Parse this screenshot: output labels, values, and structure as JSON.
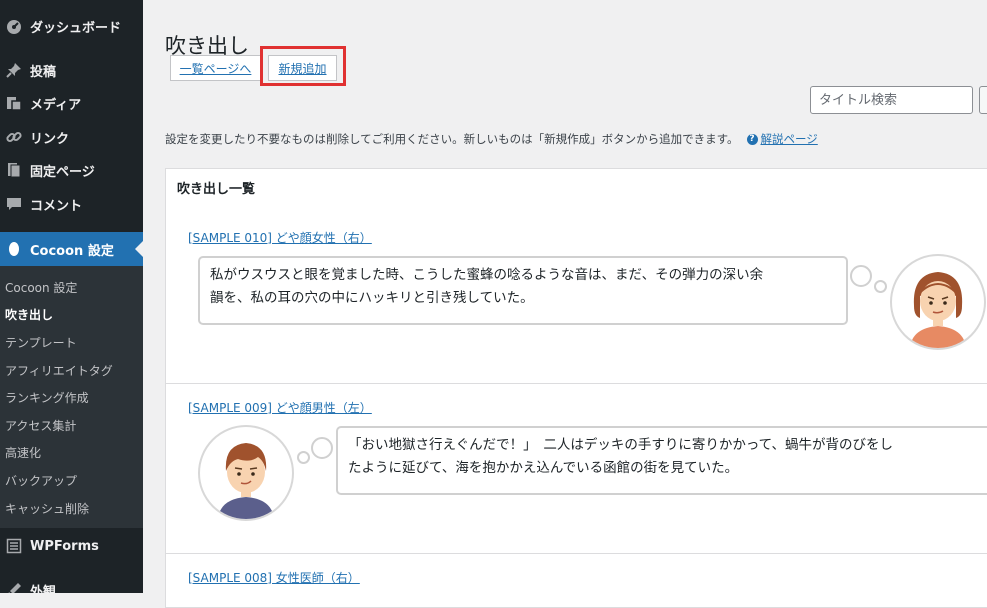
{
  "sidebar": {
    "menu": [
      {
        "label": "ダッシュボード",
        "icon": "dashboard-icon"
      },
      {
        "label": "投稿",
        "icon": "pin-icon"
      },
      {
        "label": "メディア",
        "icon": "media-icon"
      },
      {
        "label": "リンク",
        "icon": "link-icon"
      },
      {
        "label": "固定ページ",
        "icon": "page-icon"
      },
      {
        "label": "コメント",
        "icon": "comment-icon"
      },
      {
        "label": "Cocoon 設定",
        "icon": "cocoon-icon",
        "active": true
      },
      {
        "label": "WPForms",
        "icon": "forms-icon"
      },
      {
        "label": "外観",
        "icon": "appearance-icon"
      }
    ],
    "submenu": [
      "Cocoon 設定",
      "吹き出し",
      "テンプレート",
      "アフィリエイトタグ",
      "ランキング作成",
      "アクセス集計",
      "高速化",
      "バックアップ",
      "キャッシュ削除"
    ],
    "submenu_current": "吹き出し"
  },
  "page": {
    "title": "吹き出し",
    "tabs": {
      "list": "一覧ページへ",
      "new": "新規追加"
    },
    "search": {
      "placeholder": "タイトル検索"
    },
    "description": "設定を変更したり不要なものは削除してご利用ください。新しいものは「新規作成」ボタンから追加できます。",
    "help_link": "解説ページ",
    "help_icon": "?"
  },
  "panel": {
    "title": "吹き出し一覧",
    "items": [
      {
        "link": "[SAMPLE 010] どや顔女性（右）",
        "lines": [
          "私がウスウスと眼を覚ました時、こうした蜜蜂の唸るような音は、まだ、その弾力の深い余",
          "韻を、私の耳の穴の中にハッキリと引き残していた。"
        ],
        "avatar": "woman-avatar"
      },
      {
        "link": "[SAMPLE 009] どや顔男性（左）",
        "lines": [
          "「おい地獄さ行えぐんだで！」　二人はデッキの手すりに寄りかかって、蝸牛が背のびをし",
          "たように延びて、海を抱かかえ込んでいる函館の街を見ていた。"
        ],
        "avatar": "man-avatar"
      },
      {
        "link": "[SAMPLE 008] 女性医師（右）"
      }
    ]
  },
  "colors": {
    "accent": "#2271b1",
    "sidebar": "#1d2327",
    "highlight": "#e03131"
  }
}
